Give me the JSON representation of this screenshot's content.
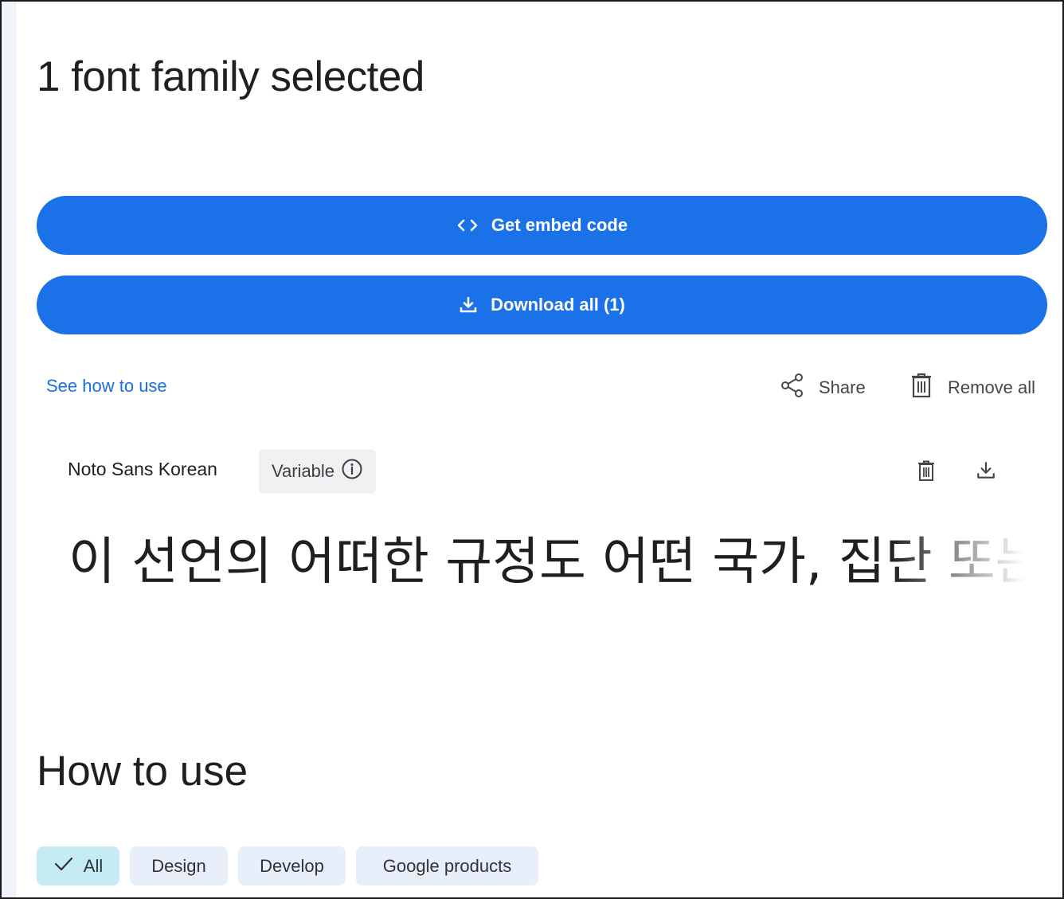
{
  "header": {
    "title": "1 font family selected"
  },
  "buttons": {
    "embed_label": "Get embed code",
    "download_label": "Download all (1)"
  },
  "actions": {
    "see_how_label": "See how to use",
    "share_label": "Share",
    "remove_all_label": "Remove all"
  },
  "font": {
    "name": "Noto Sans Korean",
    "badge_label": "Variable",
    "sample_text": "이 선언의 어떠한 규정도 어떤 국가, 집단 또는 개"
  },
  "how_to_use": {
    "title": "How to use",
    "filters": [
      {
        "label": "All",
        "selected": true
      },
      {
        "label": "Design",
        "selected": false
      },
      {
        "label": "Develop",
        "selected": false
      },
      {
        "label": "Google products",
        "selected": false
      }
    ]
  },
  "icons": {
    "embed": "code-brackets-icon",
    "download": "download-icon",
    "share": "share-icon",
    "remove": "trash-icon",
    "info": "info-icon",
    "check": "check-icon"
  },
  "colors": {
    "primary": "#1b72e8",
    "link": "#1b6fe0",
    "chip_selected": "#c5ecf5",
    "chip": "#e8effa",
    "badge": "#f0f1f3"
  }
}
